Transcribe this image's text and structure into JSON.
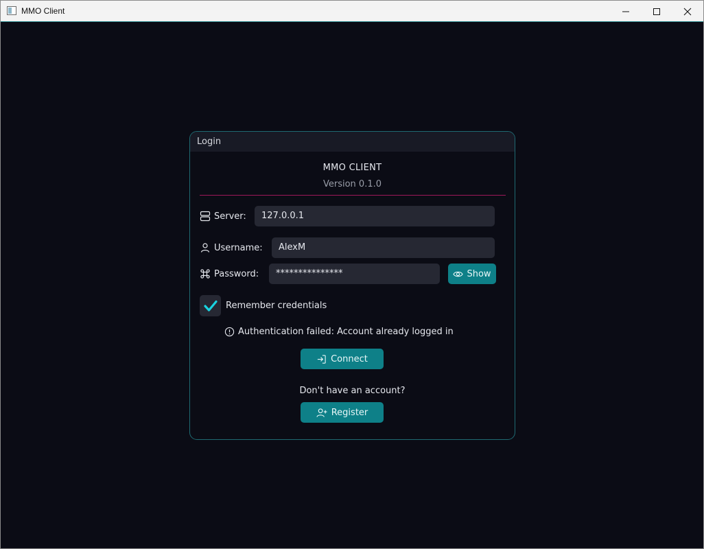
{
  "window": {
    "title": "MMO Client",
    "controls": [
      "minimize-icon",
      "maximize-icon",
      "close-icon"
    ]
  },
  "panel": {
    "title": "Login",
    "app_name": "MMO CLIENT",
    "version": "Version 0.1.0"
  },
  "form": {
    "server_label": "Server:",
    "server_value": "127.0.0.1",
    "username_label": "Username:",
    "username_value": "AlexM",
    "password_label": "Password:",
    "password_value": "***************",
    "show_label": "Show",
    "remember_label": "Remember credentials",
    "remember_checked": true
  },
  "status": {
    "error_text": "Authentication failed: Account already logged in"
  },
  "actions": {
    "connect_label": "Connect",
    "no_account_text": "Don't have an account?",
    "register_label": "Register"
  },
  "colors": {
    "background": "#0b0c15",
    "accent": "#0e8088",
    "divider": "#a0185a",
    "panel_border": "#1f6a72",
    "field": "#262833",
    "check": "#19d3e0"
  },
  "icons": {
    "server": "server-icon",
    "user": "user-icon",
    "password": "command-icon",
    "show": "eye-icon",
    "error": "alert-circle-icon",
    "connect": "login-icon",
    "register": "user-plus-icon"
  }
}
